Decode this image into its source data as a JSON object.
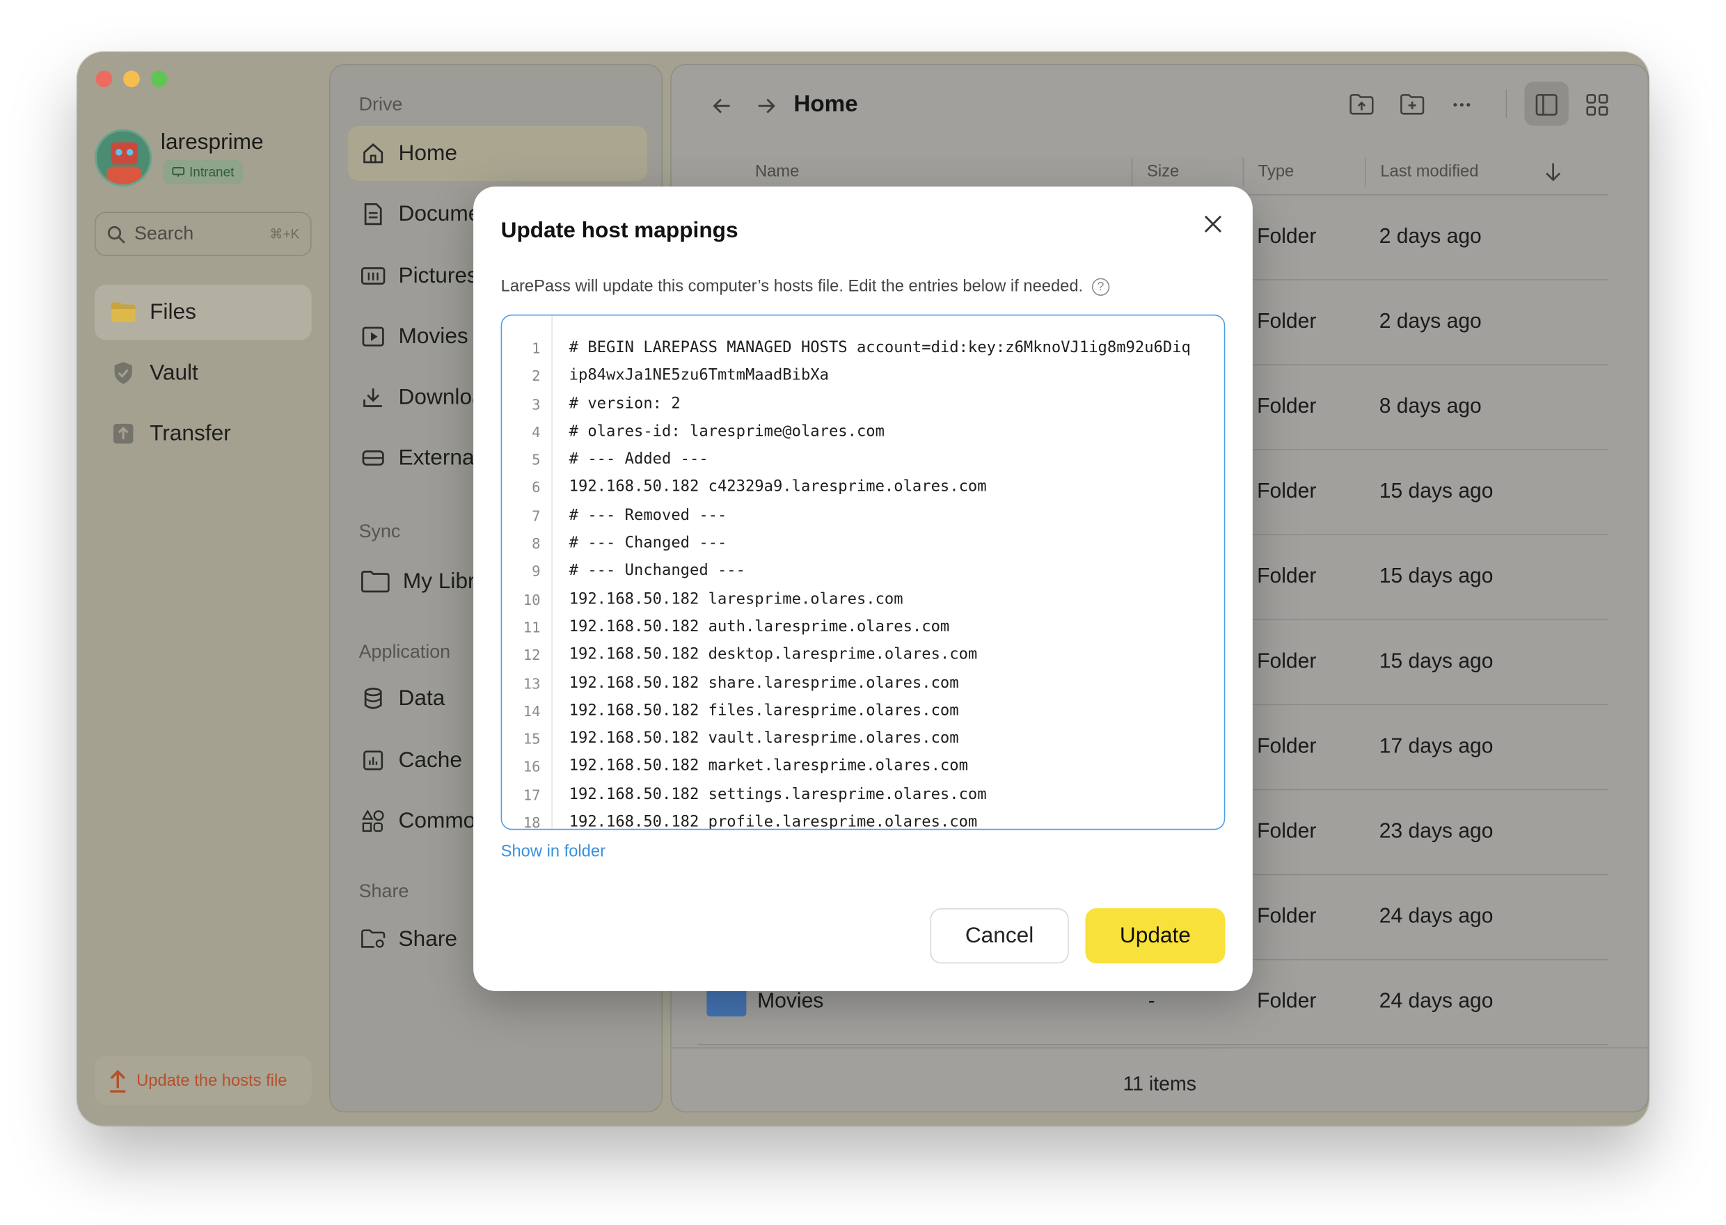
{
  "profile": {
    "username": "laresprime",
    "network_badge": "Intranet"
  },
  "search": {
    "placeholder": "Search",
    "shortcut": "⌘+K"
  },
  "sidebar": {
    "items": [
      {
        "label": "Files",
        "icon": "folder-icon",
        "active": true
      },
      {
        "label": "Vault",
        "icon": "shield-icon",
        "active": false
      },
      {
        "label": "Transfer",
        "icon": "transfer-icon",
        "active": false
      }
    ],
    "hosts_button": "Update the hosts file"
  },
  "panel2": {
    "drive_label": "Drive",
    "drive_items": [
      {
        "label": "Home",
        "icon": "home-icon",
        "active": true
      },
      {
        "label": "Documents",
        "icon": "document-icon"
      },
      {
        "label": "Pictures",
        "icon": "pictures-icon"
      },
      {
        "label": "Movies",
        "icon": "movie-icon"
      },
      {
        "label": "Downloads",
        "icon": "download-icon"
      },
      {
        "label": "External",
        "icon": "drive-icon"
      }
    ],
    "sync_label": "Sync",
    "sync_items": [
      {
        "label": "My Library",
        "icon": "folder-outline-icon"
      }
    ],
    "application_label": "Application",
    "application_items": [
      {
        "label": "Data",
        "icon": "database-icon"
      },
      {
        "label": "Cache",
        "icon": "cache-icon"
      },
      {
        "label": "Common",
        "icon": "apps-icon"
      }
    ],
    "share_label": "Share",
    "share_items": [
      {
        "label": "Share",
        "icon": "share-folder-icon"
      }
    ]
  },
  "main": {
    "breadcrumb": "Home",
    "columns": {
      "name": "Name",
      "size": "Size",
      "type": "Type",
      "modified": "Last modified"
    },
    "rows": [
      {
        "name": "",
        "size": "",
        "type": "Folder",
        "modified": "2 days ago"
      },
      {
        "name": "",
        "size": "",
        "type": "Folder",
        "modified": "2 days ago"
      },
      {
        "name": "",
        "size": "",
        "type": "Folder",
        "modified": "8 days ago"
      },
      {
        "name": "",
        "size": "",
        "type": "Folder",
        "modified": "15 days ago"
      },
      {
        "name": "",
        "size": "",
        "type": "Folder",
        "modified": "15 days ago"
      },
      {
        "name": "",
        "size": "",
        "type": "Folder",
        "modified": "15 days ago"
      },
      {
        "name": "",
        "size": "",
        "type": "Folder",
        "modified": "17 days ago"
      },
      {
        "name": "",
        "size": "",
        "type": "Folder",
        "modified": "23 days ago"
      },
      {
        "name": "",
        "size": "",
        "type": "Folder",
        "modified": "24 days ago"
      },
      {
        "name": "Movies",
        "size": "-",
        "type": "Folder",
        "modified": "24 days ago"
      }
    ],
    "footer": "11 items"
  },
  "dialog": {
    "title": "Update host mappings",
    "description": "LarePass will update this computer’s hosts file. Edit the entries below if needed.",
    "lines": [
      "# BEGIN LAREPASS MANAGED HOSTS account=did:key:z6MknoVJ1ig8m92u6Diq",
      "ip84wxJa1NE5zu6TmtmMaadBibXa",
      "# version: 2",
      "# olares-id: laresprime@olares.com",
      "# --- Added ---",
      "192.168.50.182 c42329a9.laresprime.olares.com",
      "# --- Removed ---",
      "# --- Changed ---",
      "# --- Unchanged ---",
      "192.168.50.182 laresprime.olares.com",
      "192.168.50.182 auth.laresprime.olares.com",
      "192.168.50.182 desktop.laresprime.olares.com",
      "192.168.50.182 share.laresprime.olares.com",
      "192.168.50.182 files.laresprime.olares.com",
      "192.168.50.182 vault.laresprime.olares.com",
      "192.168.50.182 market.laresprime.olares.com",
      "192.168.50.182 settings.laresprime.olares.com",
      "192.168.50.182 profile.laresprime.olares.com"
    ],
    "line_numbers": [
      "1",
      "2",
      "3",
      "4",
      "5",
      "6",
      "7",
      "8",
      "9",
      "10",
      "11",
      "12",
      "13",
      "14",
      "15",
      "16",
      "17",
      "18"
    ],
    "show_in_folder": "Show in folder",
    "cancel_label": "Cancel",
    "update_label": "Update"
  },
  "colors": {
    "accent": "#f8e13a",
    "link": "#3a8fde",
    "editor_border": "#4d9ee8",
    "warning": "#b5502a"
  }
}
